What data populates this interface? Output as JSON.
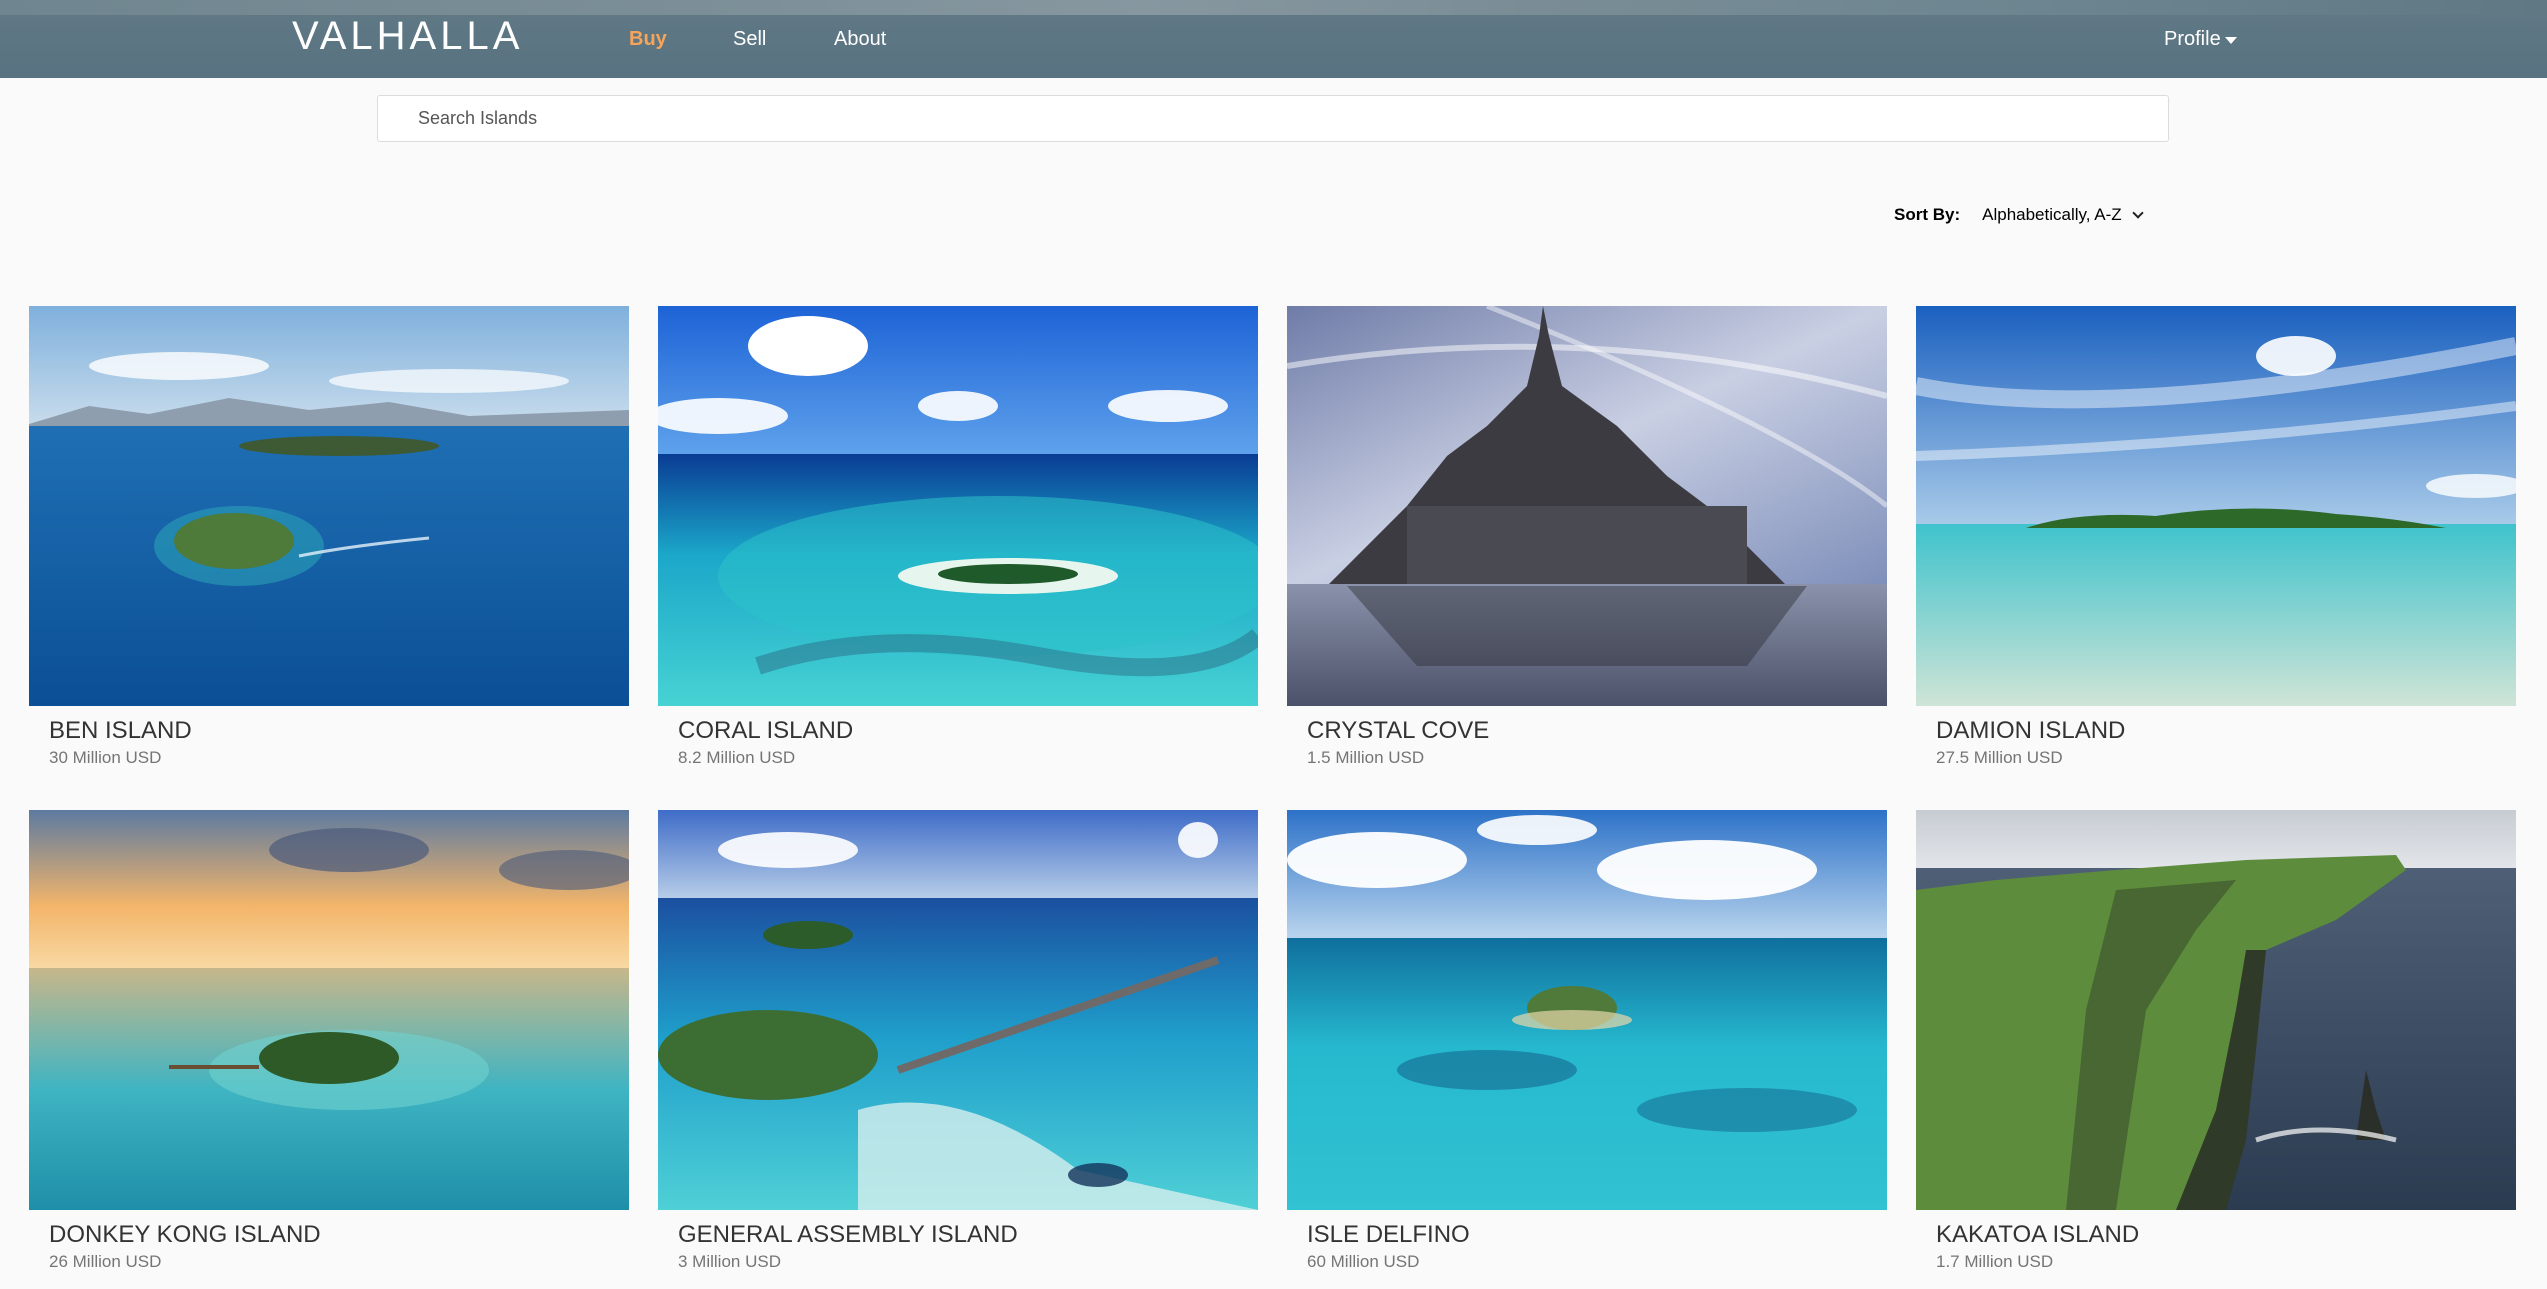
{
  "app": {
    "brand": "VALHALLA"
  },
  "nav": {
    "buy": "Buy",
    "sell": "Sell",
    "about": "About",
    "profile": "Profile"
  },
  "search": {
    "placeholder": "Search Islands",
    "value": ""
  },
  "sort": {
    "label": "Sort By:",
    "selected": "Alphabetically, A-Z"
  },
  "colors": {
    "nav_bg": "#5f7883",
    "active_link": "#f5a45a",
    "page_bg": "#fafafa"
  },
  "islands": [
    {
      "name": "BEN ISLAND",
      "price": "30 Million USD"
    },
    {
      "name": "CORAL ISLAND",
      "price": "8.2 Million USD"
    },
    {
      "name": "CRYSTAL COVE",
      "price": "1.5 Million USD"
    },
    {
      "name": "DAMION ISLAND",
      "price": "27.5 Million USD"
    },
    {
      "name": "DONKEY KONG ISLAND",
      "price": "26 Million USD"
    },
    {
      "name": "GENERAL ASSEMBLY ISLAND",
      "price": "3 Million USD"
    },
    {
      "name": "ISLE DELFINO",
      "price": "60 Million USD"
    },
    {
      "name": "KAKATOA ISLAND",
      "price": "1.7 Million USD"
    }
  ]
}
